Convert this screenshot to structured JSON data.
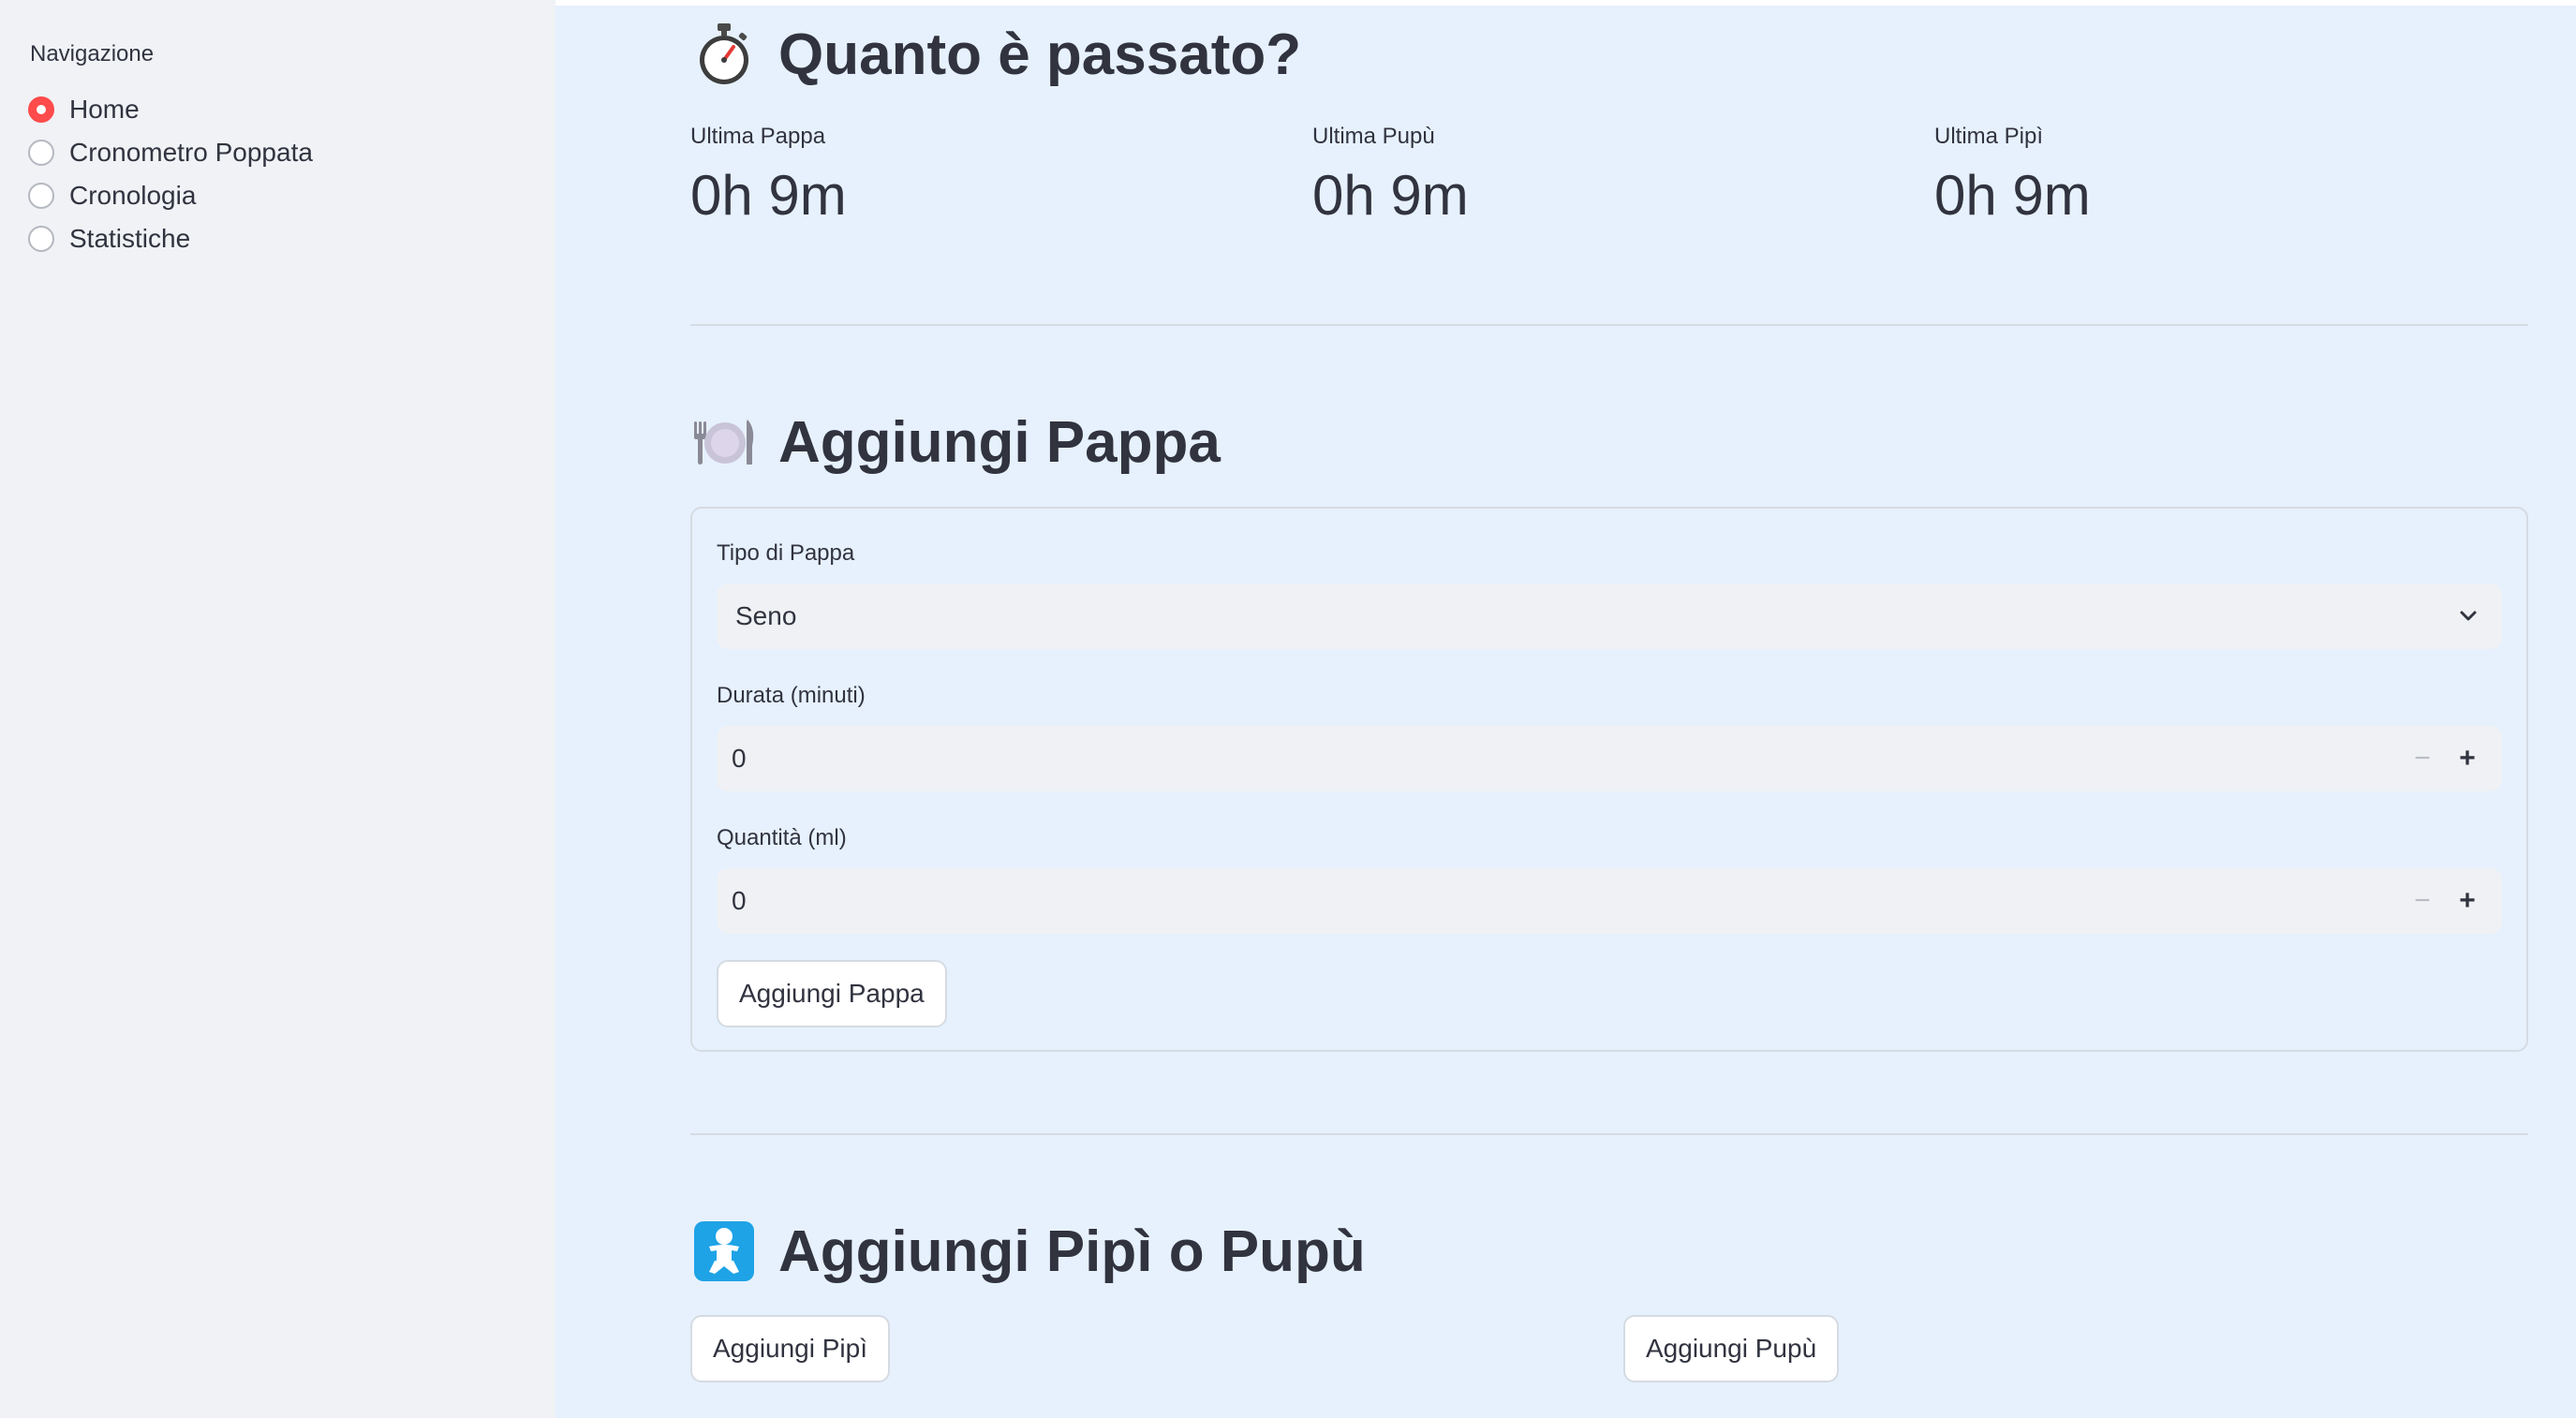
{
  "sidebar": {
    "label": "Navigazione",
    "items": [
      {
        "label": "Home",
        "selected": true
      },
      {
        "label": "Cronometro Poppata",
        "selected": false
      },
      {
        "label": "Cronologia",
        "selected": false
      },
      {
        "label": "Statistiche",
        "selected": false
      }
    ]
  },
  "elapsed": {
    "title": "Quanto è passato?",
    "icon": "stopwatch-icon",
    "metrics": [
      {
        "label": "Ultima Pappa",
        "value": "0h 9m"
      },
      {
        "label": "Ultima Pupù",
        "value": "0h 9m"
      },
      {
        "label": "Ultima Pipì",
        "value": "0h 9m"
      }
    ]
  },
  "pappa": {
    "title": "Aggiungi Pappa",
    "icon": "plate-cutlery-icon",
    "type_label": "Tipo di Pappa",
    "type_value": "Seno",
    "duration_label": "Durata (minuti)",
    "duration_value": "0",
    "quantity_label": "Quantità (ml)",
    "quantity_value": "0",
    "submit_label": "Aggiungi Pappa"
  },
  "diaper": {
    "title": "Aggiungi Pipì o Pupù",
    "icon": "baby-icon",
    "pipi_label": "Aggiungi Pipì",
    "pupu_label": "Aggiungi Pupù"
  },
  "colors": {
    "accent": "#ff4b4b",
    "main_bg": "#e6f1fd",
    "sidebar_bg": "#f0f2f6",
    "text": "#31333f"
  }
}
